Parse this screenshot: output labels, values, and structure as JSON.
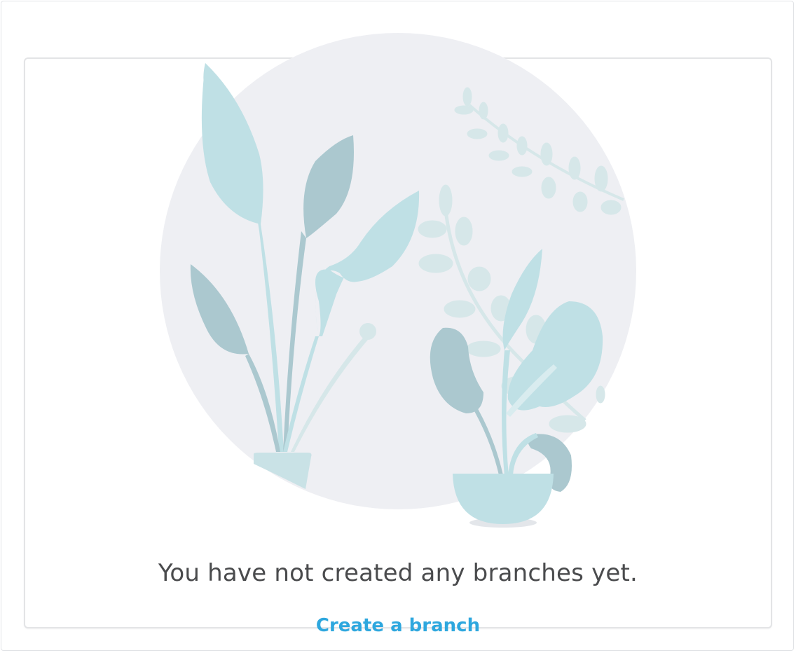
{
  "empty_state": {
    "illustration_icon": "potted-plants-illustration",
    "message": "You have not created any branches yet.",
    "action_label": "Create a branch"
  },
  "colors": {
    "circle_bg": "#eeeff3",
    "leaf_light": "#bfe0e5",
    "leaf_dark": "#abc8cf",
    "leaf_faint": "#d6e7e9",
    "link": "#2ea7de",
    "text": "#4a4b4d"
  }
}
